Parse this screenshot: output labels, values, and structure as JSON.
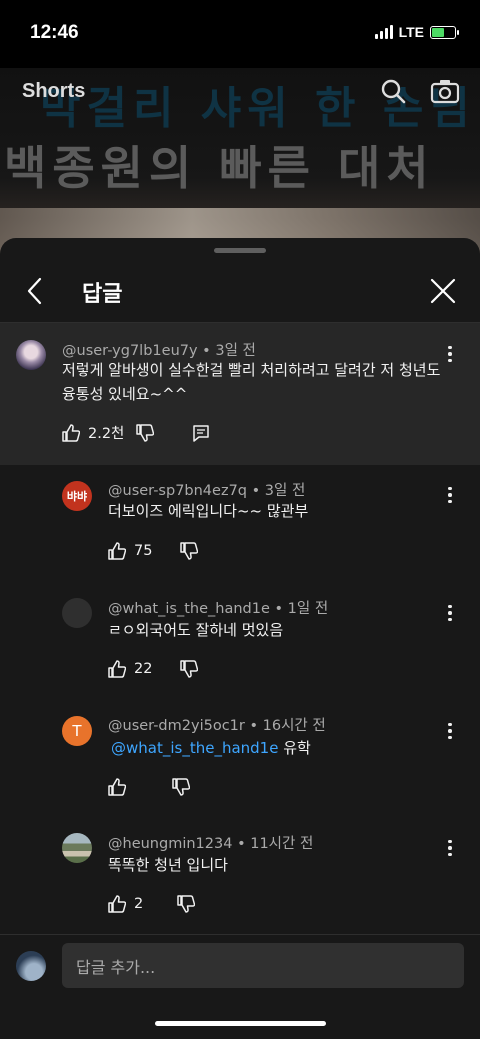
{
  "status_bar": {
    "time": "12:46",
    "network": "LTE"
  },
  "video": {
    "shorts_label": "Shorts",
    "overlay_line1": "막걸리 샤워 한 손님",
    "overlay_line2": "백종원의 빠른 대처"
  },
  "panel": {
    "title": "답글"
  },
  "parent_comment": {
    "author": "@user-yg7lb1eu7y",
    "time": "3일 전",
    "text": "저렇게 알바생이 실수한걸 빨리 처리하려고 달려간 저 청년도 융통성 있네요~^^",
    "likes": "2.2천"
  },
  "replies": [
    {
      "author": "@user-sp7bn4ez7q",
      "time": "3일 전",
      "text": "더보이즈 에릭입니다~~ 많관부",
      "likes": "75",
      "avatar_text": "뱌뱌",
      "avatar_color": "#c2331e"
    },
    {
      "author": "@what_is_the_hand1e",
      "time": "1일 전",
      "text": "ㄹㅇ외국어도 잘하네 멋있음",
      "likes": "22",
      "avatar_text": "",
      "avatar_color": "#2f2f2f"
    },
    {
      "author": "@user-dm2yi5oc1r",
      "time": "16시간 전",
      "mention": "@what_is_the_hand1e",
      "text": "유학",
      "likes": "",
      "avatar_text": "T",
      "avatar_color": "#e8732b"
    },
    {
      "author": "@heungmin1234",
      "time": "11시간 전",
      "text": "똑똑한 청년 입니다",
      "likes": "2",
      "avatar_text": "",
      "avatar_color": "#7a8f7a"
    }
  ],
  "reply_input": {
    "placeholder": "답글 추가..."
  },
  "separator": "•"
}
